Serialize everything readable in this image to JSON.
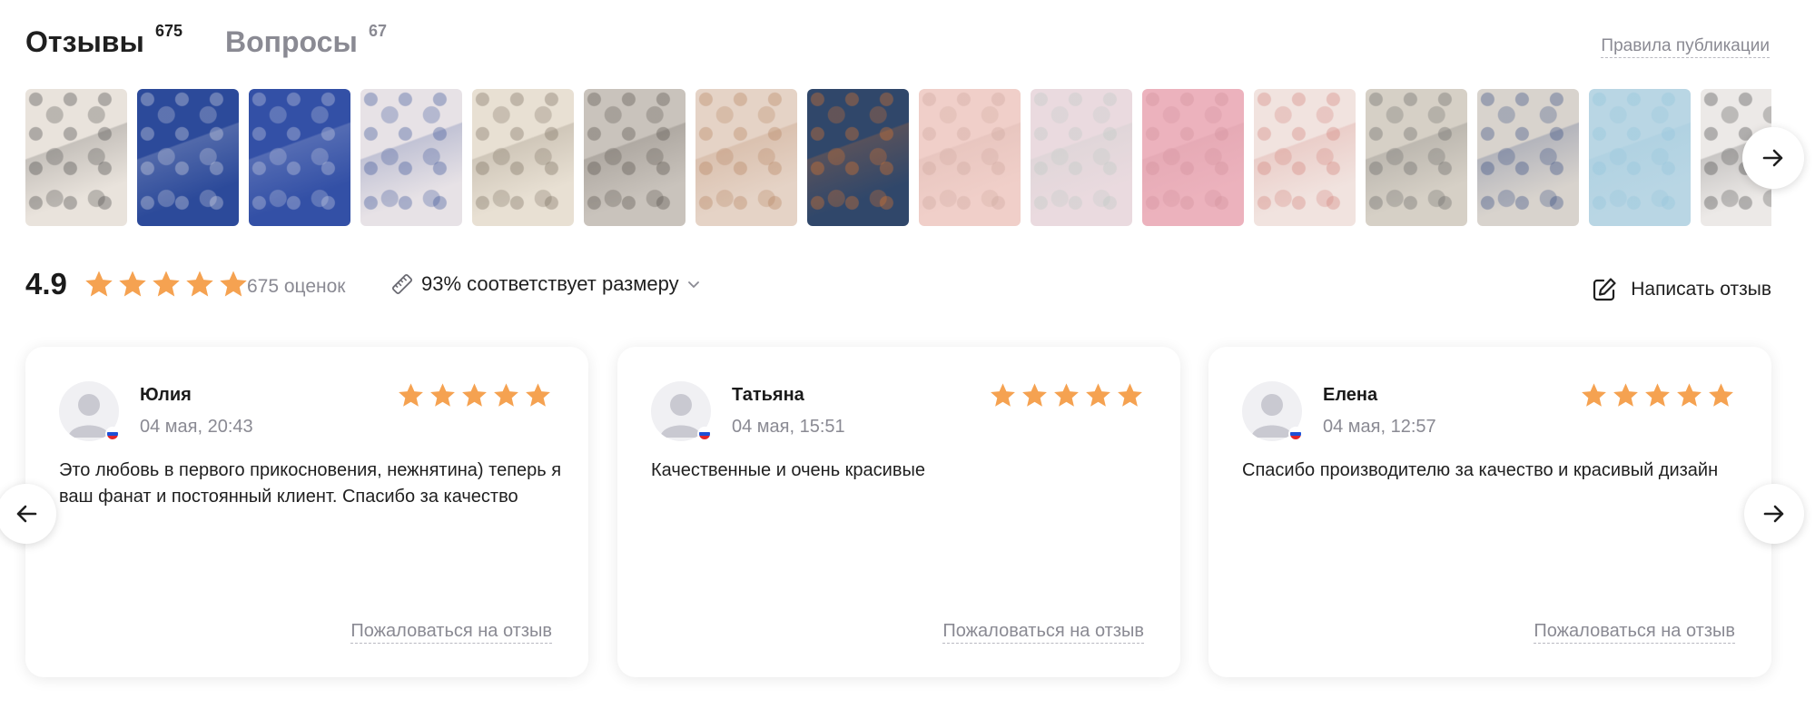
{
  "tabs": {
    "reviews": {
      "label": "Отзывы",
      "count": "675"
    },
    "questions": {
      "label": "Вопросы",
      "count": "67"
    }
  },
  "rules_link": "Правила публикации",
  "photos": [
    {
      "name": "photo-white-bodysuit-panda",
      "bg": "#e9e3dc",
      "accent": "#3a3a3a"
    },
    {
      "name": "photo-navy-romper",
      "bg": "#2c4a9a",
      "accent": "#e8e6ea"
    },
    {
      "name": "photo-navy-romper-closeup",
      "bg": "#3350a6",
      "accent": "#d9dbe7"
    },
    {
      "name": "photo-navy-romper-folded",
      "bg": "#e7e2e6",
      "accent": "#2b4590"
    },
    {
      "name": "photo-baby-print-romper",
      "bg": "#e8e0d3",
      "accent": "#6f6353"
    },
    {
      "name": "photo-baby-crawling",
      "bg": "#c9c3bc",
      "accent": "#4a443e"
    },
    {
      "name": "photo-baby-cookie-print",
      "bg": "#e5d3c6",
      "accent": "#b07a55"
    },
    {
      "name": "photo-baby-jeans",
      "bg": "#30476a",
      "accent": "#f07a24"
    },
    {
      "name": "photo-pink-snaps",
      "bg": "#f0cfc9",
      "accent": "#caa39a"
    },
    {
      "name": "photo-pink-fabric-hand",
      "bg": "#eadadf",
      "accent": "#b9c7c1"
    },
    {
      "name": "photo-pink-button",
      "bg": "#ecb2bd",
      "accent": "#cf8c98"
    },
    {
      "name": "photo-baby-donut-print",
      "bg": "#f1e3df",
      "accent": "#d07a72"
    },
    {
      "name": "photo-baby-grey-print",
      "bg": "#d6d0c6",
      "accent": "#5a5a5a"
    },
    {
      "name": "photo-baby-navy-romper",
      "bg": "#d8d3cd",
      "accent": "#233c78"
    },
    {
      "name": "photo-blue-romper",
      "bg": "#b9d6e4",
      "accent": "#8fc2da"
    },
    {
      "name": "photo-baby-white-print",
      "bg": "#ece9e7",
      "accent": "#3a3a3a"
    }
  ],
  "rating": {
    "value": "4.9",
    "stars": 4.9,
    "count_label": "675 оценок",
    "size_fit": "93% соответствует размеру",
    "write_review": "Написать отзыв"
  },
  "colors": {
    "star": "#f5a251",
    "muted": "#8a8a93",
    "text": "#1f1f1f"
  },
  "reviews": [
    {
      "name": "Юлия",
      "date": "04 мая, 20:43",
      "stars": 5,
      "text": "Это любовь в первого прикосновения, нежнятина) теперь я ваш фанат и постоянный клиент. Спасибо за качество",
      "complain": "Пожаловаться на отзыв"
    },
    {
      "name": "Татьяна",
      "date": "04 мая, 15:51",
      "stars": 5,
      "text": "Качественные и очень красивые",
      "complain": "Пожаловаться на отзыв"
    },
    {
      "name": "Елена",
      "date": "04 мая, 12:57",
      "stars": 5,
      "text": "Спасибо производителю за качество и красивый дизайн",
      "complain": "Пожаловаться на отзыв"
    }
  ]
}
